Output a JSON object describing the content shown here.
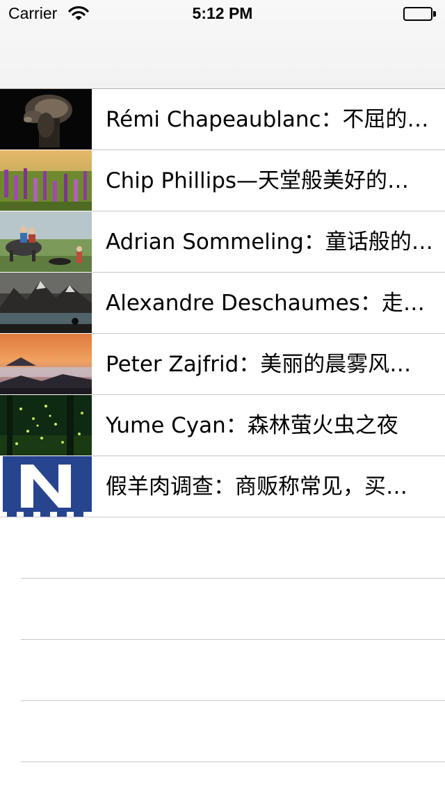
{
  "status_bar": {
    "carrier": "Carrier",
    "time": "5:12 PM",
    "wifi_icon": "wifi-icon",
    "battery_icon": "battery-icon"
  },
  "news": {
    "items": [
      {
        "title": "Rémi Chapeaublanc：不屈的…",
        "image": "camel-portrait-dark"
      },
      {
        "title": "Chip Phillips—天堂般美好的…",
        "image": "purple-flower-field"
      },
      {
        "title": "Adrian Sommeling：童话般的…",
        "image": "children-on-buffalo"
      },
      {
        "title": "Alexandre Deschaumes：走…",
        "image": "mountain-lake"
      },
      {
        "title": "Peter Zajfrid：美丽的晨雾风…",
        "image": "misty-sunrise"
      },
      {
        "title": "Yume Cyan：森林萤火虫之夜",
        "image": "firefly-forest"
      },
      {
        "title": "假羊肉调查：商贩称常见，买…",
        "image": "news-logo-n"
      }
    ]
  },
  "colors": {
    "separator": "#c8c7cc",
    "nav_background": "#f7f7f7",
    "text": "#000000"
  }
}
